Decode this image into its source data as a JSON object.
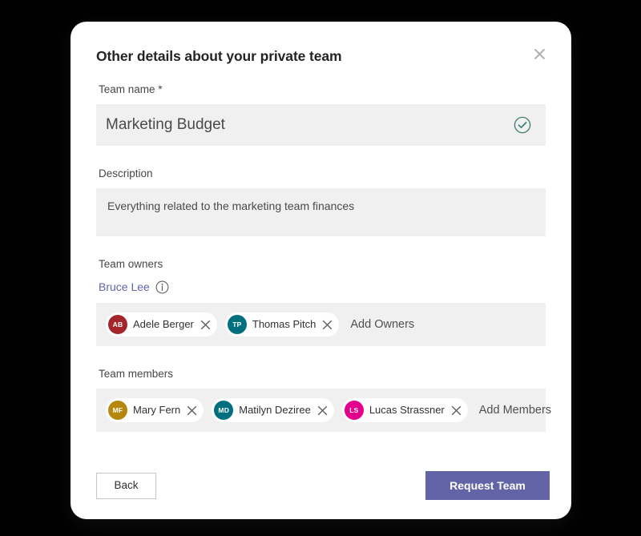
{
  "dialog": {
    "title": "Other details about your private team",
    "close_label": "Close",
    "close_icon": "close-icon"
  },
  "form": {
    "team_name": {
      "label": "Team name *",
      "value": "Marketing Budget",
      "placeholder": "Team name",
      "valid_icon": "circle-check-icon",
      "valid_color": "#3b7d6e"
    },
    "description": {
      "label": "Description",
      "value": "Everything related to the marketing team finances",
      "placeholder": "Description"
    },
    "team_owners": {
      "label": "Team owners",
      "link_name": "Bruce Lee",
      "link_color": "#6264a7",
      "info_icon": "info-circle-icon",
      "add_placeholder": "Add Owners",
      "chips": [
        {
          "initials": "AB",
          "name": "Adele Berger",
          "color": "#a4262c",
          "remove_icon": "close-icon"
        },
        {
          "initials": "TP",
          "name": "Thomas Pitch",
          "color": "#00707f",
          "remove_icon": "close-icon"
        }
      ]
    },
    "team_members": {
      "label": "Team members",
      "add_placeholder": "Add Members",
      "chips": [
        {
          "initials": "MF",
          "name": "Mary Fern",
          "color": "#b5880d",
          "remove_icon": "close-icon"
        },
        {
          "initials": "MD",
          "name": "Matilyn Deziree",
          "color": "#00707f",
          "remove_icon": "close-icon"
        },
        {
          "initials": "LS",
          "name": "Lucas Strassner",
          "color": "#e3008c",
          "remove_icon": "close-icon"
        }
      ]
    }
  },
  "footer": {
    "back_label": "Back",
    "submit_label": "Request Team",
    "submit_color": "#6264a7"
  }
}
